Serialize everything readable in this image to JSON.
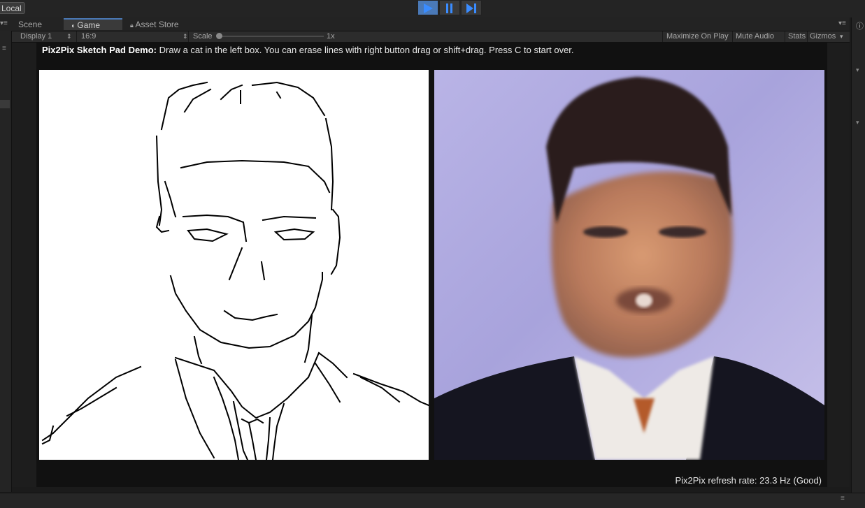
{
  "topbar": {
    "local_label": "Local",
    "play": {
      "play_icon": "play-icon",
      "pause_icon": "pause-icon",
      "step_icon": "step-icon"
    }
  },
  "tabs": {
    "scene": "Scene",
    "game": "Game",
    "asset_store": "Asset Store"
  },
  "toolbar": {
    "display": "Display 1",
    "aspect": "16:9",
    "scale_label": "Scale",
    "scale_value": "1x",
    "maximize": "Maximize On Play",
    "mute": "Mute Audio",
    "stats": "Stats",
    "gizmos": "Gizmos"
  },
  "demo": {
    "title_bold": "Pix2Pix Sketch Pad Demo:",
    "title_rest": " Draw a cat in the left box. You can erase lines with right button drag or shift+drag. Press C to start over.",
    "refresh_rate": "Pix2Pix refresh rate: 23.3 Hz (Good)"
  },
  "colors": {
    "accent": "#4a79b7",
    "editor_bg": "#1b1b1b",
    "sketch_bg": "#ffffff"
  }
}
